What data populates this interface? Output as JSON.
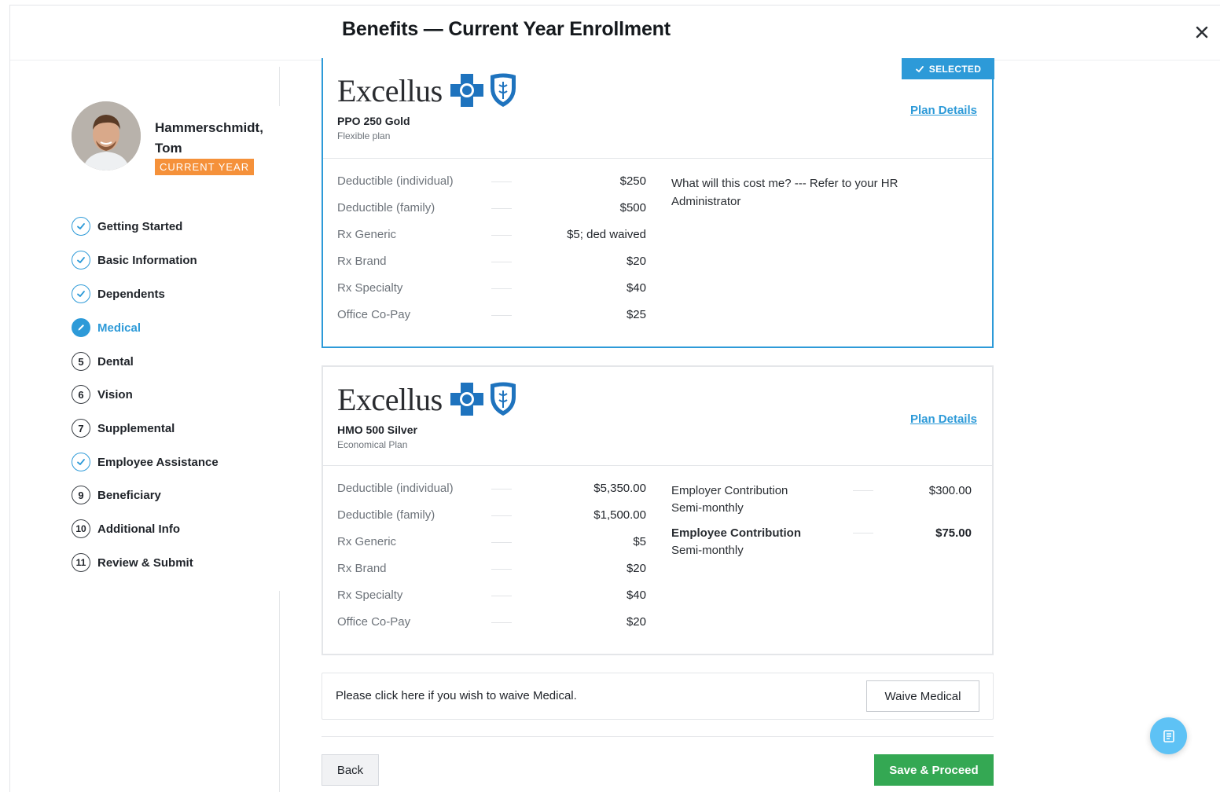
{
  "header": {
    "title": "Benefits — Current Year Enrollment"
  },
  "employee": {
    "name_line1": "Hammerschmidt,",
    "name_line2": "Tom",
    "badge": "CURRENT YEAR"
  },
  "steps": [
    {
      "label": "Getting Started",
      "state": "done"
    },
    {
      "label": "Basic Information",
      "state": "done"
    },
    {
      "label": "Dependents",
      "state": "done"
    },
    {
      "label": "Medical",
      "state": "active"
    },
    {
      "label": "Dental",
      "state": "number",
      "num": "5"
    },
    {
      "label": "Vision",
      "state": "number",
      "num": "6"
    },
    {
      "label": "Supplemental",
      "state": "number",
      "num": "7"
    },
    {
      "label": "Employee Assistance",
      "state": "done"
    },
    {
      "label": "Beneficiary",
      "state": "number",
      "num": "9"
    },
    {
      "label": "Additional Info",
      "state": "number",
      "num": "10"
    },
    {
      "label": "Review & Submit",
      "state": "number",
      "num": "11"
    }
  ],
  "plans": [
    {
      "provider": "Excellus",
      "name": "PPO 250 Gold",
      "subtitle": "Flexible plan",
      "selected_tag": "SELECTED",
      "details_link": "Plan Details",
      "rows": [
        {
          "k": "Deductible (individual)",
          "v": "$250"
        },
        {
          "k": "Deductible (family)",
          "v": "$500"
        },
        {
          "k": "Rx Generic",
          "v": "$5; ded waived"
        },
        {
          "k": "Rx Brand",
          "v": "$20"
        },
        {
          "k": "Rx Specialty",
          "v": "$40"
        },
        {
          "k": "Office Co-Pay",
          "v": "$25"
        }
      ],
      "cost_note": "What will this cost me? --- Refer to your HR Administrator"
    },
    {
      "provider": "Excellus",
      "name": "HMO 500 Silver",
      "subtitle": "Economical Plan",
      "details_link": "Plan Details",
      "rows": [
        {
          "k": "Deductible (individual)",
          "v": "$5,350.00"
        },
        {
          "k": "Deductible (family)",
          "v": "$1,500.00"
        },
        {
          "k": "Rx Generic",
          "v": "$5"
        },
        {
          "k": "Rx Brand",
          "v": "$20"
        },
        {
          "k": "Rx Specialty",
          "v": "$40"
        },
        {
          "k": "Office Co-Pay",
          "v": "$20"
        }
      ],
      "contributions": [
        {
          "k": "Employer Contribution",
          "period": "Semi-monthly",
          "v": "$300.00"
        },
        {
          "k": "Employee Contribution",
          "period": "Semi-monthly",
          "v": "$75.00"
        }
      ]
    }
  ],
  "waive": {
    "text": "Please click here if you wish to waive Medical.",
    "button": "Waive Medical"
  },
  "footer": {
    "back": "Back",
    "save": "Save & Proceed"
  },
  "colors": {
    "accent": "#2d9ad8",
    "badge": "#f5913a",
    "save": "#34a853",
    "fab": "#5ec2f5"
  },
  "icons": {
    "close": "close-icon",
    "check": "check-icon",
    "pencil": "pencil-icon",
    "fab": "list-icon"
  }
}
